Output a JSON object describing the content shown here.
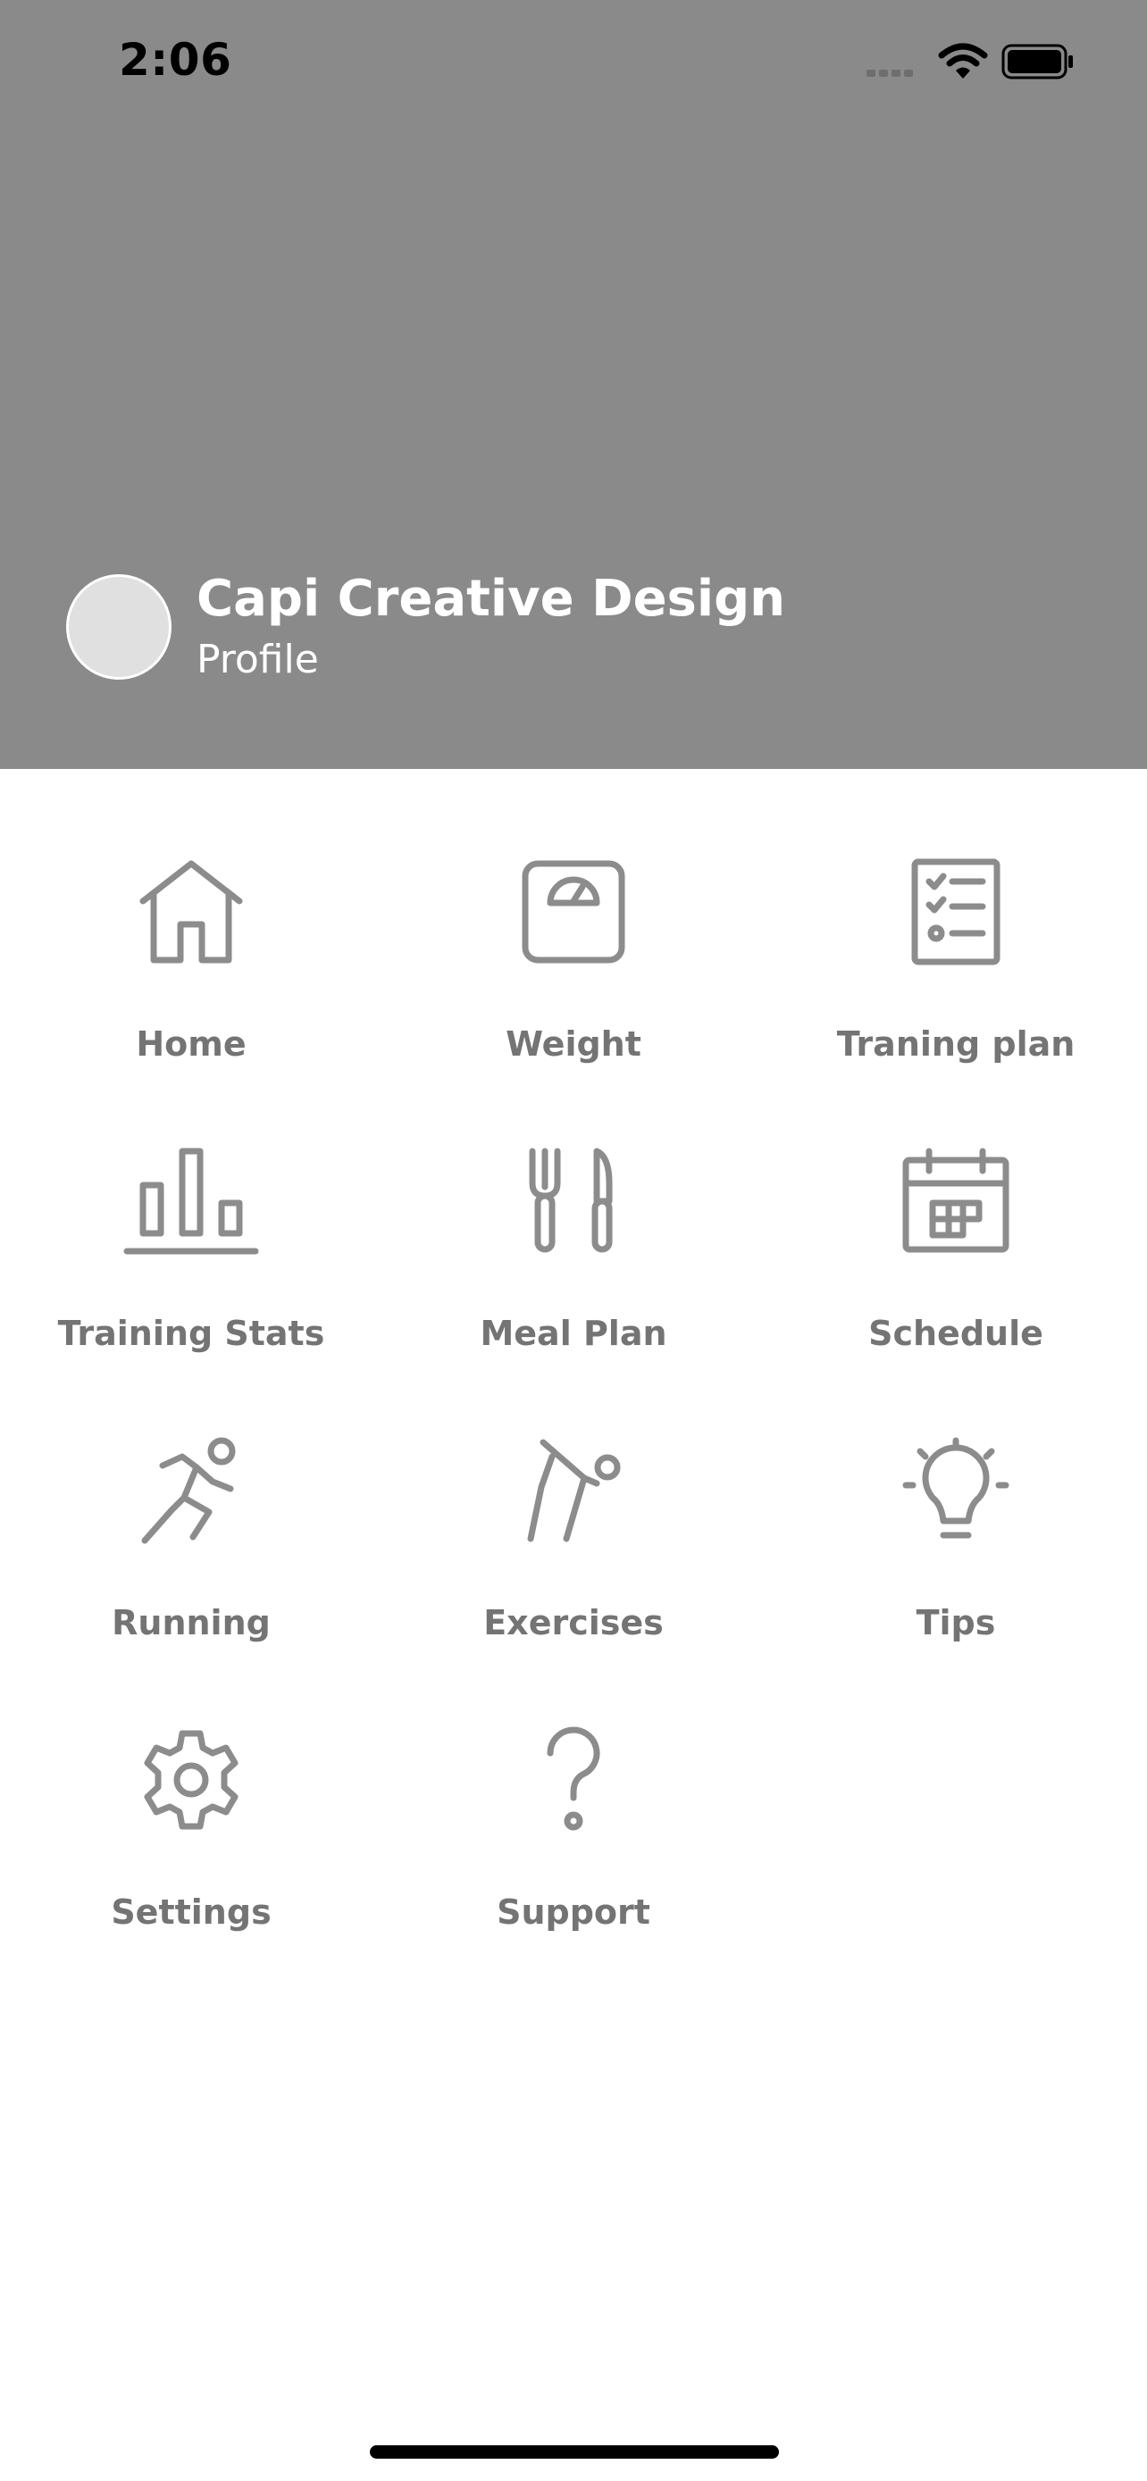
{
  "status_bar": {
    "time": "2:06",
    "icons": [
      "cellular-signal-icon",
      "wifi-icon",
      "battery-icon"
    ]
  },
  "profile": {
    "name": "Capi Creative Design",
    "link_label": "Profile"
  },
  "menu": {
    "items": [
      {
        "label": "Home",
        "icon": "home-icon"
      },
      {
        "label": "Weight",
        "icon": "scale-icon"
      },
      {
        "label": "Traning plan",
        "icon": "checklist-icon"
      },
      {
        "label": "Training Stats",
        "icon": "bar-chart-icon"
      },
      {
        "label": "Meal Plan",
        "icon": "fork-knife-icon"
      },
      {
        "label": "Schedule",
        "icon": "calendar-icon"
      },
      {
        "label": "Running",
        "icon": "running-icon"
      },
      {
        "label": "Exercises",
        "icon": "stretching-icon"
      },
      {
        "label": "Tips",
        "icon": "lightbulb-icon"
      },
      {
        "label": "Settings",
        "icon": "gear-icon"
      },
      {
        "label": "Support",
        "icon": "question-mark-icon"
      }
    ]
  },
  "colors": {
    "header_background": "#8a8a8a",
    "icon": "#8c8c8c",
    "label": "#747474",
    "avatar": "#e0e0e0"
  }
}
